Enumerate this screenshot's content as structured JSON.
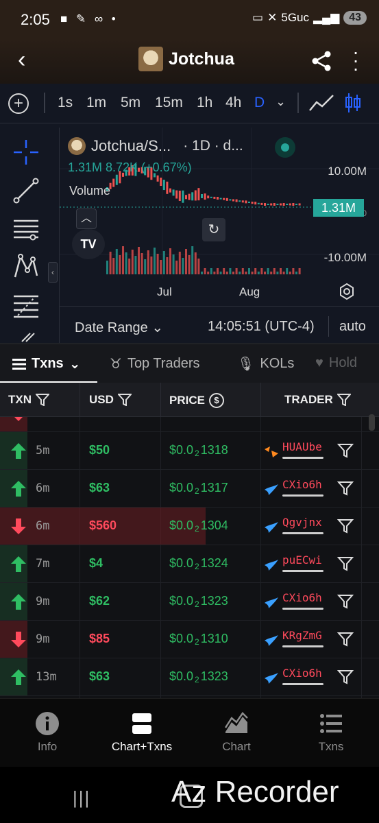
{
  "status_bar": {
    "time": "2:05",
    "left_icons": "■ ✎ ∞ •",
    "network": "5Guc",
    "battery": "43"
  },
  "header": {
    "title": "Jotchua"
  },
  "toolbar": {
    "intervals": [
      "1s",
      "1m",
      "5m",
      "15m",
      "1h",
      "4h",
      "D"
    ],
    "active_interval": "D"
  },
  "chart": {
    "symbol": "Jotchua/S...",
    "timeframe": "· 1D · d...",
    "ohlc": "1.31M  8.72K (+0.67%)",
    "volume_label": "Volume",
    "price_axis": [
      "10.00M",
      "-10.00M"
    ],
    "price_axis_partial": "0.00",
    "last_price": "1.31M",
    "x_labels": [
      "Jul",
      "Aug"
    ],
    "date_range_label": "Date Range",
    "clock": "14:05:51 (UTC-4)",
    "scale_mode": "auto",
    "colors": {
      "up": "#26a69a",
      "down": "#ef5350",
      "accent": "#2962ff"
    }
  },
  "tabs": [
    {
      "label": "Txns",
      "icon": "list-icon"
    },
    {
      "label": "Top Traders",
      "icon": "medal-icon"
    },
    {
      "label": "KOLs",
      "icon": "microphone-icon"
    },
    {
      "label": "Hold",
      "icon": "heart-icon"
    }
  ],
  "table": {
    "headers": {
      "txn": "TXN",
      "usd": "USD",
      "price": "PRICE",
      "trader": "TRADER"
    },
    "rows": [
      {
        "side": "buy",
        "age": "5m",
        "usd": "$50",
        "price_main": "$0.0",
        "price_sub": "2",
        "price_tail": "1318",
        "trader": "HUAUbe",
        "dex": "orange"
      },
      {
        "side": "buy",
        "age": "6m",
        "usd": "$63",
        "price_main": "$0.0",
        "price_sub": "2",
        "price_tail": "1317",
        "trader": "CXio6h",
        "dex": "blue"
      },
      {
        "side": "sell",
        "age": "6m",
        "usd": "$560",
        "price_main": "$0.0",
        "price_sub": "2",
        "price_tail": "1304",
        "trader": "Qgvjnx",
        "dex": "blue"
      },
      {
        "side": "buy",
        "age": "7m",
        "usd": "$4",
        "price_main": "$0.0",
        "price_sub": "2",
        "price_tail": "1324",
        "trader": "puECwi",
        "dex": "blue"
      },
      {
        "side": "buy",
        "age": "9m",
        "usd": "$62",
        "price_main": "$0.0",
        "price_sub": "2",
        "price_tail": "1323",
        "trader": "CXio6h",
        "dex": "blue"
      },
      {
        "side": "sell",
        "age": "9m",
        "usd": "$85",
        "price_main": "$0.0",
        "price_sub": "2",
        "price_tail": "1310",
        "trader": "KRgZmG",
        "dex": "blue"
      },
      {
        "side": "buy",
        "age": "13m",
        "usd": "$63",
        "price_main": "$0.0",
        "price_sub": "2",
        "price_tail": "1323",
        "trader": "CXio6h",
        "dex": "blue"
      }
    ]
  },
  "bottom_nav": [
    {
      "label": "Info",
      "icon": "info-icon"
    },
    {
      "label": "Chart+Txns",
      "icon": "split-view-icon",
      "active": true
    },
    {
      "label": "Chart",
      "icon": "area-chart-icon"
    },
    {
      "label": "Txns",
      "icon": "list-icon"
    }
  ],
  "watermark": "Az Recorder"
}
